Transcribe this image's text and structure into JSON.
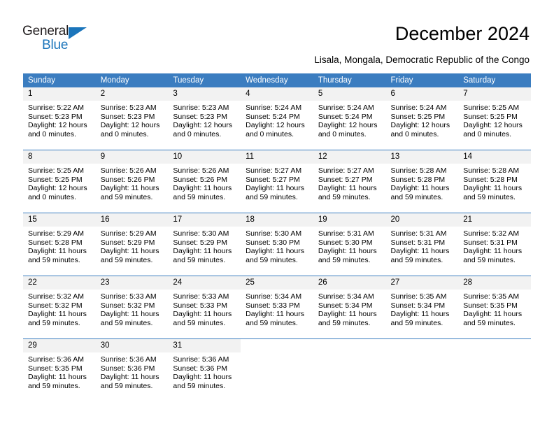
{
  "brand": {
    "name_part1": "General",
    "name_part2": "Blue",
    "accent_color": "#1b75bb"
  },
  "header": {
    "title": "December 2024",
    "subtitle": "Lisala, Mongala, Democratic Republic of the Congo"
  },
  "theme": {
    "header_row_color": "#3b7dc0",
    "daynum_band_color": "#f2f2f2",
    "text_color": "#000000"
  },
  "weekday_headers": [
    "Sunday",
    "Monday",
    "Tuesday",
    "Wednesday",
    "Thursday",
    "Friday",
    "Saturday"
  ],
  "weeks": [
    [
      {
        "day": "1",
        "sunrise": "Sunrise: 5:22 AM",
        "sunset": "Sunset: 5:23 PM",
        "daylight_line1": "Daylight: 12 hours",
        "daylight_line2": "and 0 minutes."
      },
      {
        "day": "2",
        "sunrise": "Sunrise: 5:23 AM",
        "sunset": "Sunset: 5:23 PM",
        "daylight_line1": "Daylight: 12 hours",
        "daylight_line2": "and 0 minutes."
      },
      {
        "day": "3",
        "sunrise": "Sunrise: 5:23 AM",
        "sunset": "Sunset: 5:23 PM",
        "daylight_line1": "Daylight: 12 hours",
        "daylight_line2": "and 0 minutes."
      },
      {
        "day": "4",
        "sunrise": "Sunrise: 5:24 AM",
        "sunset": "Sunset: 5:24 PM",
        "daylight_line1": "Daylight: 12 hours",
        "daylight_line2": "and 0 minutes."
      },
      {
        "day": "5",
        "sunrise": "Sunrise: 5:24 AM",
        "sunset": "Sunset: 5:24 PM",
        "daylight_line1": "Daylight: 12 hours",
        "daylight_line2": "and 0 minutes."
      },
      {
        "day": "6",
        "sunrise": "Sunrise: 5:24 AM",
        "sunset": "Sunset: 5:25 PM",
        "daylight_line1": "Daylight: 12 hours",
        "daylight_line2": "and 0 minutes."
      },
      {
        "day": "7",
        "sunrise": "Sunrise: 5:25 AM",
        "sunset": "Sunset: 5:25 PM",
        "daylight_line1": "Daylight: 12 hours",
        "daylight_line2": "and 0 minutes."
      }
    ],
    [
      {
        "day": "8",
        "sunrise": "Sunrise: 5:25 AM",
        "sunset": "Sunset: 5:25 PM",
        "daylight_line1": "Daylight: 12 hours",
        "daylight_line2": "and 0 minutes."
      },
      {
        "day": "9",
        "sunrise": "Sunrise: 5:26 AM",
        "sunset": "Sunset: 5:26 PM",
        "daylight_line1": "Daylight: 11 hours",
        "daylight_line2": "and 59 minutes."
      },
      {
        "day": "10",
        "sunrise": "Sunrise: 5:26 AM",
        "sunset": "Sunset: 5:26 PM",
        "daylight_line1": "Daylight: 11 hours",
        "daylight_line2": "and 59 minutes."
      },
      {
        "day": "11",
        "sunrise": "Sunrise: 5:27 AM",
        "sunset": "Sunset: 5:27 PM",
        "daylight_line1": "Daylight: 11 hours",
        "daylight_line2": "and 59 minutes."
      },
      {
        "day": "12",
        "sunrise": "Sunrise: 5:27 AM",
        "sunset": "Sunset: 5:27 PM",
        "daylight_line1": "Daylight: 11 hours",
        "daylight_line2": "and 59 minutes."
      },
      {
        "day": "13",
        "sunrise": "Sunrise: 5:28 AM",
        "sunset": "Sunset: 5:28 PM",
        "daylight_line1": "Daylight: 11 hours",
        "daylight_line2": "and 59 minutes."
      },
      {
        "day": "14",
        "sunrise": "Sunrise: 5:28 AM",
        "sunset": "Sunset: 5:28 PM",
        "daylight_line1": "Daylight: 11 hours",
        "daylight_line2": "and 59 minutes."
      }
    ],
    [
      {
        "day": "15",
        "sunrise": "Sunrise: 5:29 AM",
        "sunset": "Sunset: 5:28 PM",
        "daylight_line1": "Daylight: 11 hours",
        "daylight_line2": "and 59 minutes."
      },
      {
        "day": "16",
        "sunrise": "Sunrise: 5:29 AM",
        "sunset": "Sunset: 5:29 PM",
        "daylight_line1": "Daylight: 11 hours",
        "daylight_line2": "and 59 minutes."
      },
      {
        "day": "17",
        "sunrise": "Sunrise: 5:30 AM",
        "sunset": "Sunset: 5:29 PM",
        "daylight_line1": "Daylight: 11 hours",
        "daylight_line2": "and 59 minutes."
      },
      {
        "day": "18",
        "sunrise": "Sunrise: 5:30 AM",
        "sunset": "Sunset: 5:30 PM",
        "daylight_line1": "Daylight: 11 hours",
        "daylight_line2": "and 59 minutes."
      },
      {
        "day": "19",
        "sunrise": "Sunrise: 5:31 AM",
        "sunset": "Sunset: 5:30 PM",
        "daylight_line1": "Daylight: 11 hours",
        "daylight_line2": "and 59 minutes."
      },
      {
        "day": "20",
        "sunrise": "Sunrise: 5:31 AM",
        "sunset": "Sunset: 5:31 PM",
        "daylight_line1": "Daylight: 11 hours",
        "daylight_line2": "and 59 minutes."
      },
      {
        "day": "21",
        "sunrise": "Sunrise: 5:32 AM",
        "sunset": "Sunset: 5:31 PM",
        "daylight_line1": "Daylight: 11 hours",
        "daylight_line2": "and 59 minutes."
      }
    ],
    [
      {
        "day": "22",
        "sunrise": "Sunrise: 5:32 AM",
        "sunset": "Sunset: 5:32 PM",
        "daylight_line1": "Daylight: 11 hours",
        "daylight_line2": "and 59 minutes."
      },
      {
        "day": "23",
        "sunrise": "Sunrise: 5:33 AM",
        "sunset": "Sunset: 5:32 PM",
        "daylight_line1": "Daylight: 11 hours",
        "daylight_line2": "and 59 minutes."
      },
      {
        "day": "24",
        "sunrise": "Sunrise: 5:33 AM",
        "sunset": "Sunset: 5:33 PM",
        "daylight_line1": "Daylight: 11 hours",
        "daylight_line2": "and 59 minutes."
      },
      {
        "day": "25",
        "sunrise": "Sunrise: 5:34 AM",
        "sunset": "Sunset: 5:33 PM",
        "daylight_line1": "Daylight: 11 hours",
        "daylight_line2": "and 59 minutes."
      },
      {
        "day": "26",
        "sunrise": "Sunrise: 5:34 AM",
        "sunset": "Sunset: 5:34 PM",
        "daylight_line1": "Daylight: 11 hours",
        "daylight_line2": "and 59 minutes."
      },
      {
        "day": "27",
        "sunrise": "Sunrise: 5:35 AM",
        "sunset": "Sunset: 5:34 PM",
        "daylight_line1": "Daylight: 11 hours",
        "daylight_line2": "and 59 minutes."
      },
      {
        "day": "28",
        "sunrise": "Sunrise: 5:35 AM",
        "sunset": "Sunset: 5:35 PM",
        "daylight_line1": "Daylight: 11 hours",
        "daylight_line2": "and 59 minutes."
      }
    ],
    [
      {
        "day": "29",
        "sunrise": "Sunrise: 5:36 AM",
        "sunset": "Sunset: 5:35 PM",
        "daylight_line1": "Daylight: 11 hours",
        "daylight_line2": "and 59 minutes."
      },
      {
        "day": "30",
        "sunrise": "Sunrise: 5:36 AM",
        "sunset": "Sunset: 5:36 PM",
        "daylight_line1": "Daylight: 11 hours",
        "daylight_line2": "and 59 minutes."
      },
      {
        "day": "31",
        "sunrise": "Sunrise: 5:36 AM",
        "sunset": "Sunset: 5:36 PM",
        "daylight_line1": "Daylight: 11 hours",
        "daylight_line2": "and 59 minutes."
      },
      {
        "day": "",
        "sunrise": "",
        "sunset": "",
        "daylight_line1": "",
        "daylight_line2": ""
      },
      {
        "day": "",
        "sunrise": "",
        "sunset": "",
        "daylight_line1": "",
        "daylight_line2": ""
      },
      {
        "day": "",
        "sunrise": "",
        "sunset": "",
        "daylight_line1": "",
        "daylight_line2": ""
      },
      {
        "day": "",
        "sunrise": "",
        "sunset": "",
        "daylight_line1": "",
        "daylight_line2": ""
      }
    ]
  ]
}
